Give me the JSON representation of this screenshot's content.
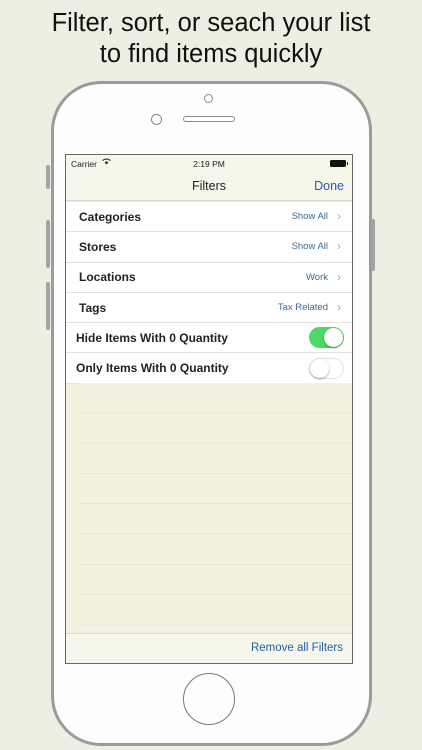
{
  "headline": {
    "line1": "Filter, sort, or seach your list",
    "line2": "to find items quickly"
  },
  "statusbar": {
    "carrier": "Carrier",
    "wifi_icon": "wifi-icon",
    "time": "2:19 PM",
    "battery_icon": "battery-icon"
  },
  "navbar": {
    "title": "Filters",
    "done_label": "Done"
  },
  "filters": [
    {
      "label": "Categories",
      "value": "Show All"
    },
    {
      "label": "Stores",
      "value": "Show All"
    },
    {
      "label": "Locations",
      "value": "Work"
    },
    {
      "label": "Tags",
      "value": "Tax Related"
    }
  ],
  "toggles": [
    {
      "label": "Hide Items With 0 Quantity",
      "on": true
    },
    {
      "label": "Only Items With 0 Quantity",
      "on": false
    }
  ],
  "footer": {
    "remove_label": "Remove all Filters"
  },
  "colors": {
    "background": "#efeee2",
    "accent": "#1f5fa6",
    "toggle_on": "#4cd964"
  }
}
